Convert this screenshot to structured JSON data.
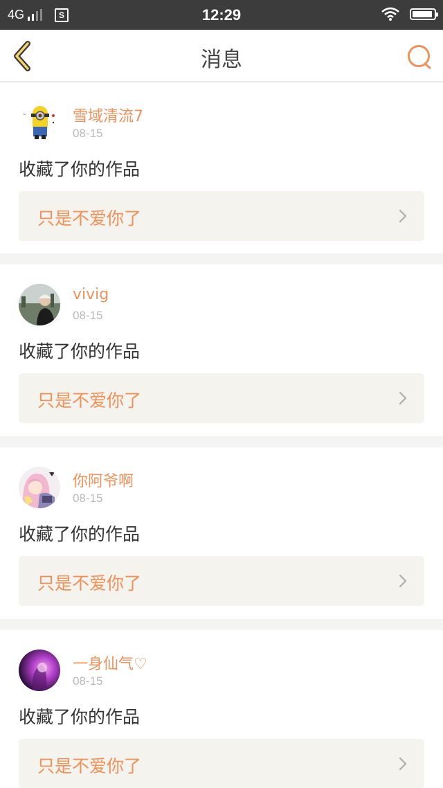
{
  "status_bar": {
    "network": "4G",
    "sim_icon_letter": "S",
    "time": "12:29",
    "battery_level": 0.95
  },
  "nav": {
    "title": "消息",
    "back_icon": "chevron-left-icon",
    "search_icon": "search-icon",
    "accent": "#f0915a"
  },
  "notifications": [
    {
      "username": "雪域清流7",
      "date": "08-15",
      "action": "收藏了你的作品",
      "work_title": "只是不爱你了",
      "avatar": "minion-avatar"
    },
    {
      "username": "vivig",
      "date": "08-15",
      "action": "收藏了你的作品",
      "work_title": "只是不爱你了",
      "avatar": "person-photo-avatar"
    },
    {
      "username": "你阿爷啊",
      "date": "08-15",
      "action": "收藏了你的作品",
      "work_title": "只是不爱你了",
      "avatar": "anime-girl-avatar"
    },
    {
      "username": "一身仙气♡",
      "date": "08-15",
      "action": "收藏了你的作品",
      "work_title": "只是不爱你了",
      "avatar": "purple-glow-avatar"
    }
  ]
}
